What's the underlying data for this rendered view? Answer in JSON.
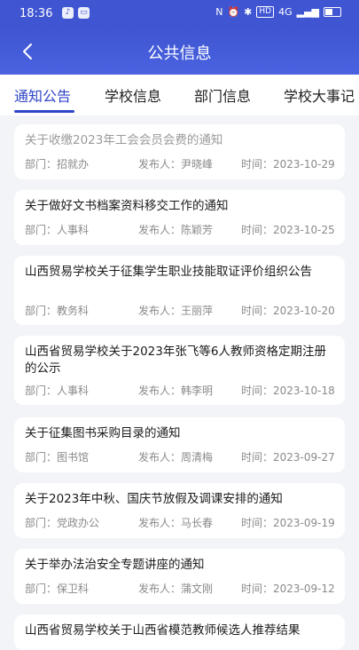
{
  "status_bar": {
    "time": "18:36",
    "apps": [
      "tiktok-icon",
      "chat-icon"
    ],
    "icons": [
      "nfc-icon",
      "alarm-icon",
      "bluetooth-icon",
      "hd-icon",
      "signal-4g-icon",
      "signal-icon",
      "battery-icon"
    ],
    "hd_label": "HD",
    "net_label": "4G"
  },
  "header": {
    "title": "公共信息",
    "back_icon": "chevron-left-icon"
  },
  "tabs": [
    {
      "label": "通知公告",
      "active": true
    },
    {
      "label": "学校信息",
      "active": false
    },
    {
      "label": "部门信息",
      "active": false
    },
    {
      "label": "学校大事记",
      "active": false
    }
  ],
  "meta_labels": {
    "dept": "部门：",
    "publisher": "发布人：",
    "time": "时间："
  },
  "notices": [
    {
      "title": "关于收缴2023年工会会员会费的通知",
      "dept": "招就办",
      "publisher": "尹晓峰",
      "time": "2023-10-29"
    },
    {
      "title": "关于做好文书档案资料移交工作的通知",
      "dept": "人事科",
      "publisher": "陈颖芳",
      "time": "2023-10-25"
    },
    {
      "title": "山西贸易学校关于征集学生职业技能取证评价组织公告",
      "dept": "教务科",
      "publisher": "王丽萍",
      "time": "2023-10-20"
    },
    {
      "title": "山西省贸易学校关于2023年张飞等6人教师资格定期注册的公示",
      "dept": "人事科",
      "publisher": "韩李明",
      "time": "2023-10-18"
    },
    {
      "title": "关于征集图书采购目录的通知",
      "dept": "图书馆",
      "publisher": "周清梅",
      "time": "2023-09-27"
    },
    {
      "title": "关于2023年中秋、国庆节放假及调课安排的通知",
      "dept": "党政办公",
      "publisher": "马长春",
      "time": "2023-09-19"
    },
    {
      "title": "关于举办法治安全专题讲座的通知",
      "dept": "保卫科",
      "publisher": "蒲文刚",
      "time": "2023-09-12"
    },
    {
      "title": "山西省贸易学校关于山西省模范教师候选人推荐结果",
      "dept": "",
      "publisher": "",
      "time": ""
    }
  ],
  "colors": {
    "primary": "#3f55d2",
    "tab_active": "#2f46c8",
    "background": "#f3f4f8"
  }
}
